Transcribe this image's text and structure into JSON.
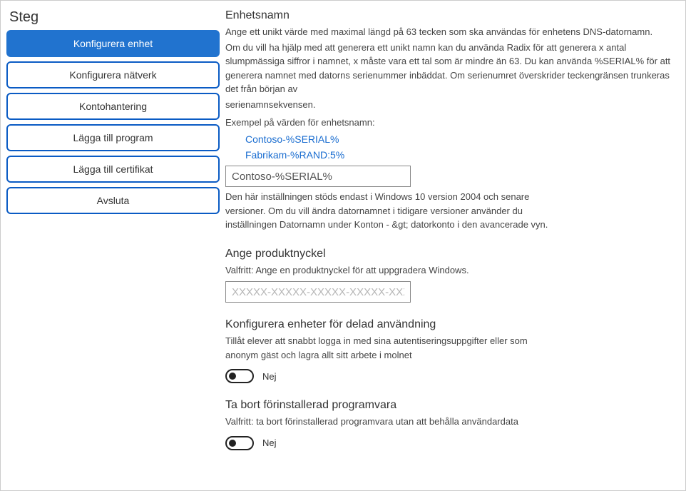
{
  "sidebar": {
    "title": "Steg",
    "items": [
      {
        "label": "Konfigurera enhet",
        "active": true
      },
      {
        "label": "Konfigurera nätverk",
        "active": false
      },
      {
        "label": "Kontohantering",
        "active": false
      },
      {
        "label": "Lägga till program",
        "active": false
      },
      {
        "label": "Lägga till certifikat",
        "active": false
      },
      {
        "label": "Avsluta",
        "active": false
      }
    ]
  },
  "device_name": {
    "heading": "Enhetsnamn",
    "desc1": "Ange ett unikt värde med maximal längd på 63 tecken som ska användas för enhetens DNS-datornamn.",
    "desc2": "Om du vill ha hjälp med att generera ett unikt namn kan du använda Radix för att generera x antal slumpmässiga siffror i namnet, x måste vara ett tal som är mindre än 63. Du kan använda %SERIAL% för att generera namnet med datorns serienummer inbäddat. Om serienumret överskrider teckengränsen trunkeras det från början av",
    "desc2_small": "serienamnsekvensen.",
    "example_label": "Exempel på värden för enhetsnamn:",
    "example1": "Contoso-%SERIAL%",
    "example2": "Fabrikam-%RAND:5%",
    "input_value": "Contoso-%SERIAL%",
    "note": "Den här inställningen stöds endast i Windows 10 version 2004 och senare versioner. Om du vill ändra datornamnet i tidigare versioner använder du inställningen Datornamn under Konton - &gt; datorkonto i den avancerade vyn."
  },
  "product_key": {
    "heading": "Ange produktnyckel",
    "desc": "Valfritt: Ange en produktnyckel för att uppgradera Windows.",
    "placeholder": "XXXXX-XXXXX-XXXXX-XXXXX-XXXXX"
  },
  "shared_use": {
    "heading": "Konfigurera enheter för delad användning",
    "desc": "Tillåt elever att snabbt logga in med sina autentiseringsuppgifter eller som anonym gäst och lagra allt sitt arbete i molnet",
    "toggle_label": "Nej"
  },
  "remove_software": {
    "heading": "Ta bort förinstallerad programvara",
    "desc": "Valfritt: ta bort förinstallerad programvara utan att behålla användardata",
    "toggle_label": "Nej"
  }
}
